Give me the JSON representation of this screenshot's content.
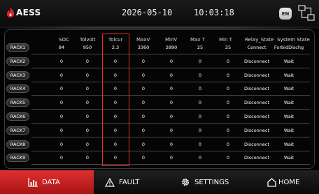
{
  "header": {
    "brand": "AESS",
    "date": "2026-05-10",
    "time": "10:03:18",
    "lang_label": "EN"
  },
  "table": {
    "columns": [
      "SOC",
      "Tolvolt",
      "Tolcur",
      "MaxV",
      "MinV",
      "Max T",
      "Min T",
      "Relay_State",
      "System State"
    ],
    "rows": [
      {
        "label": "RACK1",
        "values": [
          "84",
          "950",
          "2.3",
          "3360",
          "2890",
          "25",
          "25",
          "Connect",
          "ForbidDischg"
        ]
      },
      {
        "label": "RACK2",
        "values": [
          "0",
          "0",
          "0",
          "0",
          "0",
          "0",
          "0",
          "Disconnect",
          "Wait"
        ]
      },
      {
        "label": "RACK3",
        "values": [
          "0",
          "0",
          "0",
          "0",
          "0",
          "0",
          "0",
          "Disconnect",
          "Wait"
        ]
      },
      {
        "label": "RACK4",
        "values": [
          "0",
          "0",
          "0",
          "0",
          "0",
          "0",
          "0",
          "Disconnect",
          "Wait"
        ]
      },
      {
        "label": "RACK5",
        "values": [
          "0",
          "0",
          "0",
          "0",
          "0",
          "0",
          "0",
          "Disconnect",
          "Wait"
        ]
      },
      {
        "label": "RACK6",
        "values": [
          "0",
          "0",
          "0",
          "0",
          "0",
          "0",
          "0",
          "Disconnect",
          "Wait"
        ]
      },
      {
        "label": "RACK7",
        "values": [
          "0",
          "0",
          "0",
          "0",
          "0",
          "0",
          "0",
          "Disconnect",
          "Wait"
        ]
      },
      {
        "label": "RACK8",
        "values": [
          "0",
          "0",
          "0",
          "0",
          "0",
          "0",
          "0",
          "Disconnect",
          "Wait"
        ]
      },
      {
        "label": "RACK9",
        "values": [
          "0",
          "0",
          "0",
          "0",
          "0",
          "0",
          "0",
          "Disconnect",
          "Wait"
        ]
      }
    ]
  },
  "nav": {
    "data_label": "DATA",
    "fault_label": "FAULT",
    "settings_label": "SETTINGS",
    "home_label": "HOME"
  },
  "colors": {
    "accent": "#d42222",
    "highlight_border": "#e0302f"
  },
  "icons": [
    "flame-logo-icon",
    "network-icon",
    "bar-chart-icon",
    "warning-icon",
    "gear-icon",
    "home-icon"
  ]
}
